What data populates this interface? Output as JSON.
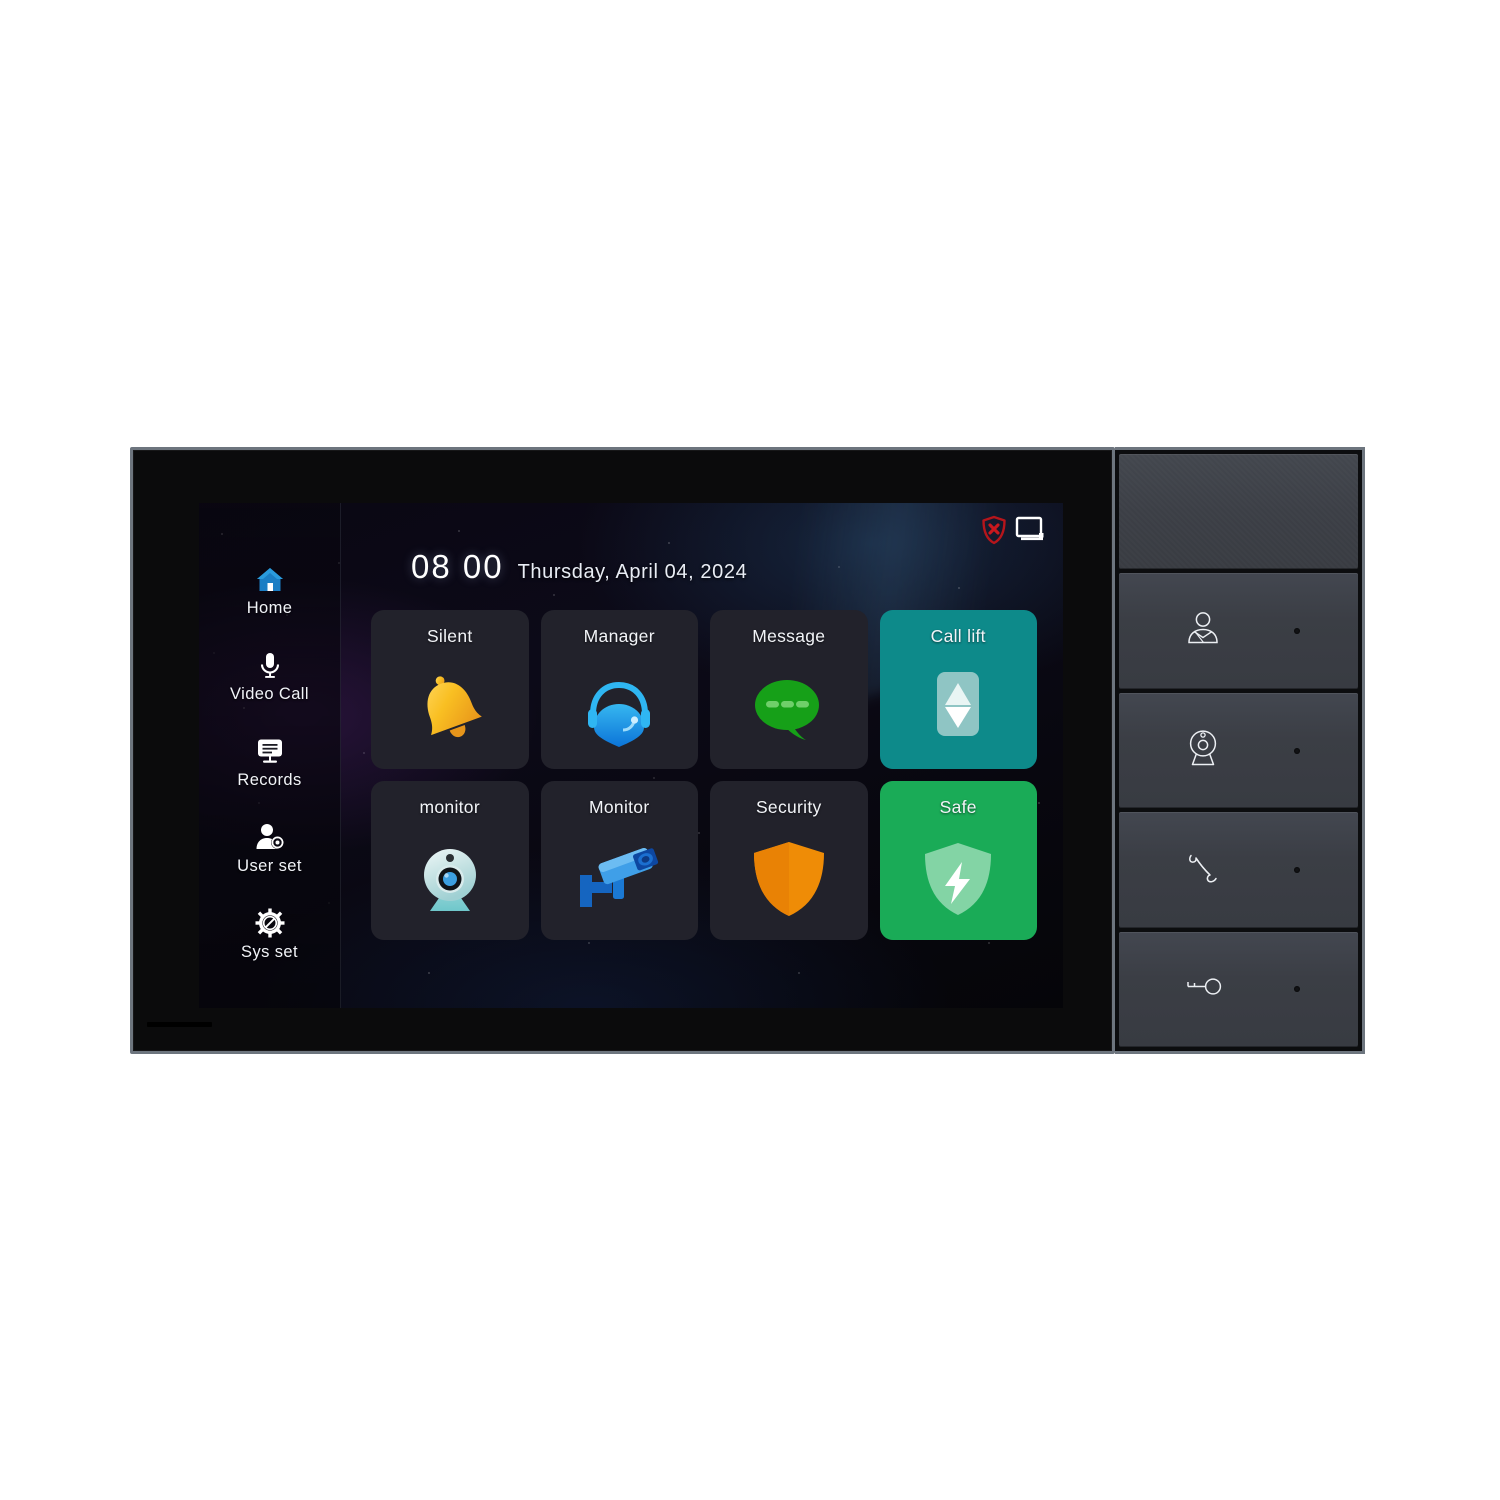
{
  "device": {
    "name": "video-intercom-indoor-monitor",
    "mic_slot": "microphone-slot"
  },
  "screen": {
    "statusbar": {
      "icons": [
        {
          "name": "shield-x-icon",
          "meaning": "security-disarmed",
          "color": "#b5151b"
        },
        {
          "name": "monitor-icon",
          "meaning": "display-connected",
          "color": "#ffffff"
        }
      ]
    },
    "clock": {
      "time": "08 00",
      "date": "Thursday, April 04,  2024"
    },
    "sidebar": {
      "items": [
        {
          "label": "Home",
          "icon": "home-icon"
        },
        {
          "label": "Video Call",
          "icon": "microphone-icon"
        },
        {
          "label": "Records",
          "icon": "records-screen-icon"
        },
        {
          "label": "User set",
          "icon": "user-settings-icon"
        },
        {
          "label": "Sys set",
          "icon": "gear-slash-icon"
        }
      ]
    },
    "tiles": [
      {
        "label": "Silent",
        "icon": "bell-icon",
        "accent": "none",
        "bg": "#22222b"
      },
      {
        "label": "Manager",
        "icon": "headset-icon",
        "accent": "none",
        "bg": "#22222b"
      },
      {
        "label": "Message",
        "icon": "chat-bubble-icon",
        "accent": "none",
        "bg": "#22222b"
      },
      {
        "label": "Call lift",
        "icon": "elevator-icon",
        "accent": "teal",
        "bg": "#0d8a8a"
      },
      {
        "label": "monitor",
        "icon": "webcam-icon",
        "accent": "none",
        "bg": "#22222b"
      },
      {
        "label": "Monitor",
        "icon": "cctv-camera-icon",
        "accent": "none",
        "bg": "#22222b"
      },
      {
        "label": "Security",
        "icon": "shield-orange-icon",
        "accent": "none",
        "bg": "#22222b"
      },
      {
        "label": "Safe",
        "icon": "shield-bolt-icon",
        "accent": "green",
        "bg": "#1aab57"
      }
    ]
  },
  "hardware_buttons": [
    {
      "name": "speaker-grille",
      "icon": "none",
      "led": false
    },
    {
      "name": "concierge-button",
      "icon": "person-icon",
      "led": true
    },
    {
      "name": "monitor-button",
      "icon": "camera-icon",
      "led": true
    },
    {
      "name": "talk-button",
      "icon": "handset-icon",
      "led": true
    },
    {
      "name": "unlock-button",
      "icon": "key-icon",
      "led": true
    }
  ]
}
